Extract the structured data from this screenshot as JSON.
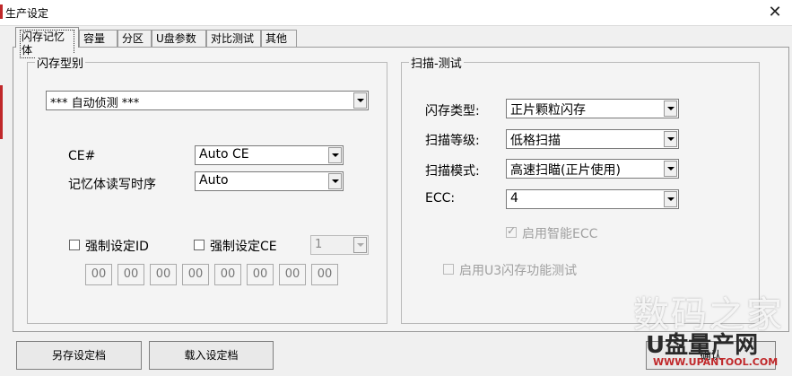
{
  "window": {
    "title": "生产设定",
    "close_glyph": "✕"
  },
  "tabs": [
    {
      "label": "闪存记忆体",
      "active": true
    },
    {
      "label": "容量"
    },
    {
      "label": "分区"
    },
    {
      "label": "U盘参数"
    },
    {
      "label": "对比测试"
    },
    {
      "label": "其他"
    }
  ],
  "flash_type_group": {
    "title": "闪存型别",
    "detect_value": "*** 自动侦测 ***",
    "ce_label": "CE#",
    "ce_value": "Auto CE",
    "timing_label": "记忆体读写时序",
    "timing_value": "Auto",
    "force_id_label": "强制设定ID",
    "force_ce_label": "强制设定CE",
    "force_ce_value": "1",
    "id_bytes": [
      "00",
      "00",
      "00",
      "00",
      "00",
      "00",
      "00",
      "00"
    ]
  },
  "scan_group": {
    "title": "扫描-测试",
    "flash_kind_label": "闪存类型:",
    "flash_kind_value": "正片颗粒闪存",
    "scan_level_label": "扫描等级:",
    "scan_level_value": "低格扫描",
    "scan_mode_label": "扫描模式:",
    "scan_mode_value": "高速扫瞄(正片使用)",
    "ecc_label": "ECC:",
    "ecc_value": "4",
    "smart_ecc_label": "启用智能ECC",
    "u3_test_label": "启用U3闪存功能测试"
  },
  "buttons": {
    "save_label": "另存设定档",
    "load_label": "载入设定档",
    "ok_label": "确认"
  },
  "watermark": {
    "line1": "数码之家",
    "line2": "U盘量产网",
    "line3": "WWW.UPANTOOL.COM"
  },
  "colors": {
    "window_bg": "#f0f0f0",
    "disabled_text": "#a0a0a0",
    "accent_red": "#c0282a"
  }
}
